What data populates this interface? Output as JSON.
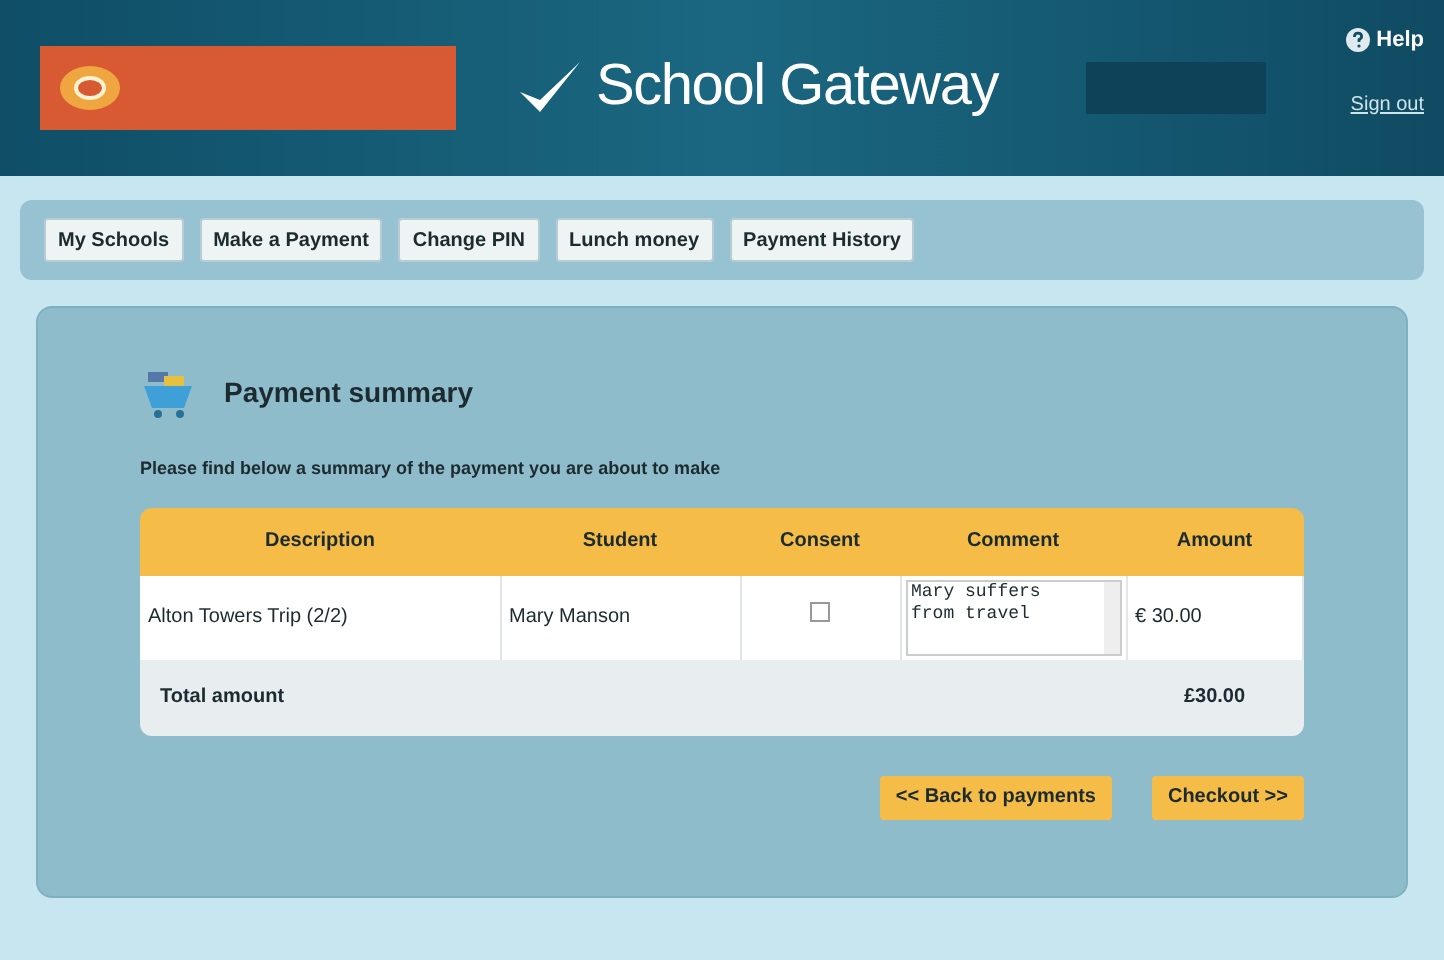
{
  "header": {
    "app_title": "School Gateway",
    "help": "Help",
    "sign_out": "Sign out"
  },
  "nav": [
    {
      "label": "My Schools"
    },
    {
      "label": "Make a Payment"
    },
    {
      "label": "Change PIN"
    },
    {
      "label": "Lunch money"
    },
    {
      "label": "Payment History"
    }
  ],
  "summary": {
    "title": "Payment summary",
    "intro": "Please find below a summary of the payment you are about to make"
  },
  "table": {
    "columns": [
      "Description",
      "Student",
      "Consent",
      "Comment",
      "Amount"
    ],
    "rows": [
      {
        "description": "Alton Towers Trip (2/2)",
        "student": "Mary Manson",
        "consent": {
          "checked": false
        },
        "comment": "Mary suffers from travel",
        "amount": "€ 30.00"
      }
    ],
    "total": {
      "label": "Total amount",
      "amount": "£30.00"
    }
  },
  "buttons": [
    "<< Back to payments",
    "Checkout >>"
  ]
}
